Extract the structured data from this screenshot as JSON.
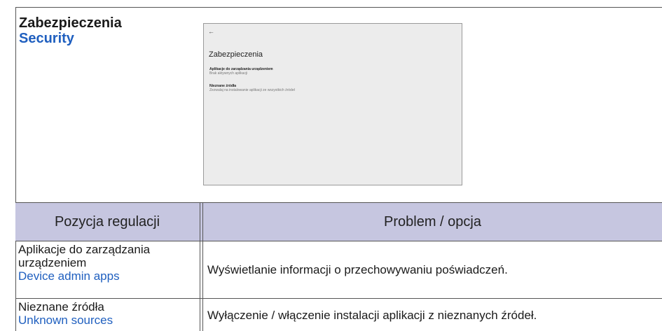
{
  "section": {
    "title_pl": "Zabezpieczenia",
    "title_en": "Security"
  },
  "screenshot": {
    "back_icon": "back-arrow-icon",
    "title": "Zabezpieczenia",
    "items": [
      {
        "label": "Aplikacje do zarządzania urządzeniem",
        "subtitle": "Brak aktywnych aplikacji"
      },
      {
        "label": "Nieznane źródła",
        "subtitle": "Zezwalaj na instalowanie aplikacji ze wszystkich źródeł"
      }
    ]
  },
  "table": {
    "headers": [
      "Pozycja regulacji",
      "Problem / opcja"
    ],
    "rows": [
      {
        "item_pl": "Aplikacje do zarządzania urządzeniem",
        "item_en": "Device admin apps",
        "description": "Wyświetlanie informacji o przechowywaniu poświadczeń."
      },
      {
        "item_pl": "Nieznane źródła",
        "item_en": "Unknown sources",
        "description": "Wyłączenie / włączenie instalacji aplikacji z nieznanych źródeł."
      }
    ]
  }
}
